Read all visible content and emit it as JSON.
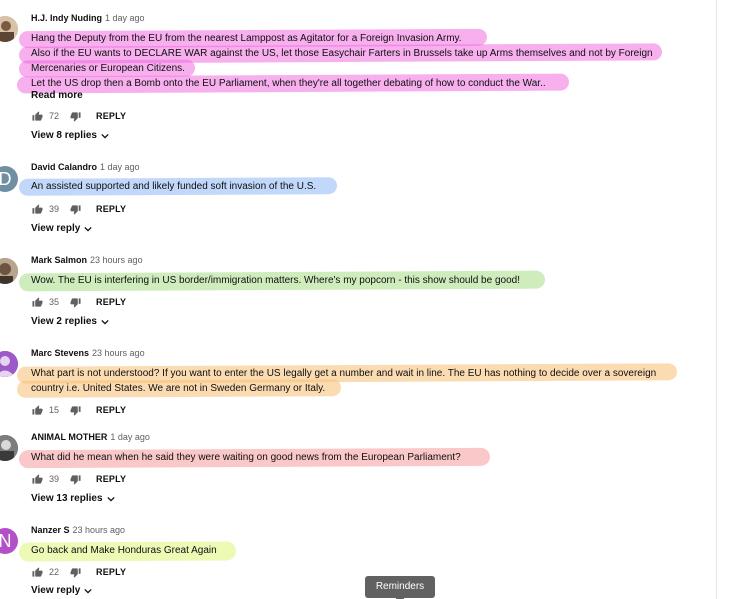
{
  "comments": [
    {
      "author": "H.J. Indy Nuding",
      "time": "1 day ago",
      "lines": [
        "Hang the Deputy from the EU from the nearest Lamppost as Agitator for a Foreign Invasion Army.",
        "Also if the EU wants to DECLARE WAR against the US, let those Easychair Farters in Brussels take up Arms themselves and not by Foreign",
        "Mercenaries or European Citizens.",
        "Let the US drop then a Bomb onto the EU Parliament, when they're all together debating of how to conduct the War.."
      ],
      "read_more": "Read more",
      "likes": "72",
      "reply": "REPLY",
      "view_replies": "View 8 replies",
      "highlight_color": "#f06ee0"
    },
    {
      "author": "David Calandro",
      "time": "1 day ago",
      "lines": [
        "An assisted supported and likely funded soft invasion of the U.S."
      ],
      "likes": "39",
      "reply": "REPLY",
      "view_replies": "View reply",
      "avatar_letter": "D",
      "highlight_color": "#8fb8f5"
    },
    {
      "author": "Mark Salmon",
      "time": "23 hours ago",
      "lines": [
        "Wow.  The EU is interfering in US border/immigration matters.  Where's my popcorn - this show should be good!"
      ],
      "likes": "35",
      "reply": "REPLY",
      "view_replies": "View 2 replies",
      "highlight_color": "#a8dc86"
    },
    {
      "author": "Marc Stevens",
      "time": "23 hours ago",
      "lines": [
        "What part is not understood? If you want to enter the US legally get a number and wait in line. The EU has nothing to decide over a sovereign",
        "country i.e. United States. We are not in Sweden Germany or Italy."
      ],
      "likes": "15",
      "reply": "REPLY",
      "highlight_color": "#f7bf73"
    },
    {
      "author": "ANIMAL MOTHER",
      "time": "1 day ago",
      "lines": [
        "What did he mean when he said they were waiting on good news from the European Parliament?"
      ],
      "likes": "39",
      "reply": "REPLY",
      "view_replies": "View 13 replies",
      "highlight_color": "#f59a9a"
    },
    {
      "author": "Nanzer S",
      "time": "23 hours ago",
      "lines": [
        "Go back and Make Honduras Great Again"
      ],
      "likes": "22",
      "reply": "REPLY",
      "view_replies": "View reply",
      "avatar_letter": "N",
      "highlight_color": "#ddf57a"
    }
  ],
  "tooltip": "Reminders",
  "colors": {
    "avatar_david": "#6f8fa3",
    "avatar_marc": "#9c59c7",
    "avatar_nanzer": "#b34fc7"
  },
  "icons": [
    "thumbs-up-icon",
    "thumbs-down-icon",
    "chevron-down-icon"
  ]
}
